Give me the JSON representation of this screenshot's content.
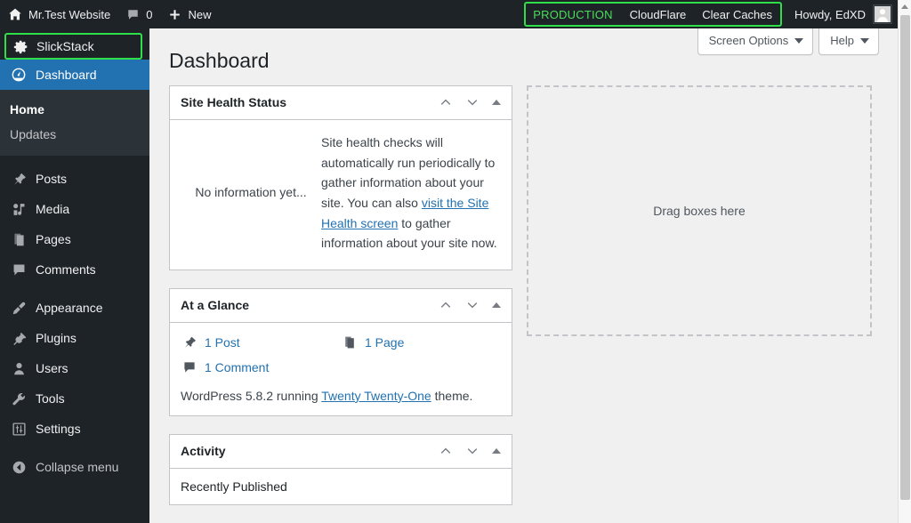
{
  "adminbar": {
    "site_icon": "home-icon",
    "site_name": "Mr.Test Website",
    "comments_icon": "comment-icon",
    "comments_count": "0",
    "new_icon": "plus-icon",
    "new_label": "New",
    "production_label": "PRODUCTION",
    "cloudflare_label": "CloudFlare",
    "clear_caches_label": "Clear Caches",
    "howdy_label": "Howdy, EdXD",
    "avatar_icon": "user-avatar-icon",
    "highlight_color": "#2fdf4a",
    "production_color": "#4ade5a",
    "background_color": "#1d2327"
  },
  "sidebar": {
    "slickstack": {
      "label": "SlickStack",
      "icon": "gear-icon",
      "highlight_color": "#2fdf4a"
    },
    "dashboard": {
      "label": "Dashboard",
      "icon": "dashboard-icon",
      "active": true,
      "active_color": "#2271b1"
    },
    "submenu": [
      {
        "label": "Home",
        "current": true
      },
      {
        "label": "Updates",
        "current": false
      }
    ],
    "items": [
      {
        "label": "Posts",
        "icon": "pin-icon"
      },
      {
        "label": "Media",
        "icon": "media-icon"
      },
      {
        "label": "Pages",
        "icon": "pages-icon"
      },
      {
        "label": "Comments",
        "icon": "comment-icon"
      }
    ],
    "items2": [
      {
        "label": "Appearance",
        "icon": "brush-icon"
      },
      {
        "label": "Plugins",
        "icon": "plug-icon"
      },
      {
        "label": "Users",
        "icon": "user-icon"
      },
      {
        "label": "Tools",
        "icon": "wrench-icon"
      },
      {
        "label": "Settings",
        "icon": "sliders-icon"
      }
    ],
    "collapse": {
      "label": "Collapse menu",
      "icon": "collapse-arrow-icon"
    }
  },
  "screen_meta": {
    "screen_options_label": "Screen Options",
    "help_label": "Help"
  },
  "main": {
    "page_title": "Dashboard",
    "widgets": {
      "site_health": {
        "title": "Site Health Status",
        "no_info": "No information yet...",
        "text_before_link": "Site health checks will automatically run periodically to gather information about your site. You can also ",
        "link_text": "visit the Site Health screen",
        "text_after_link": " to gather information about your site now."
      },
      "at_a_glance": {
        "title": "At a Glance",
        "counts": [
          {
            "icon": "pin-icon",
            "label": "1 Post"
          },
          {
            "icon": "pages-icon",
            "label": "1 Page"
          },
          {
            "icon": "comment-icon",
            "label": "1 Comment"
          }
        ],
        "version_prefix": "WordPress 5.8.2 running ",
        "theme_link": "Twenty Twenty-One",
        "version_suffix": " theme."
      },
      "activity": {
        "title": "Activity",
        "recently_published": "Recently Published"
      }
    },
    "drag_placeholder": "Drag boxes here"
  }
}
